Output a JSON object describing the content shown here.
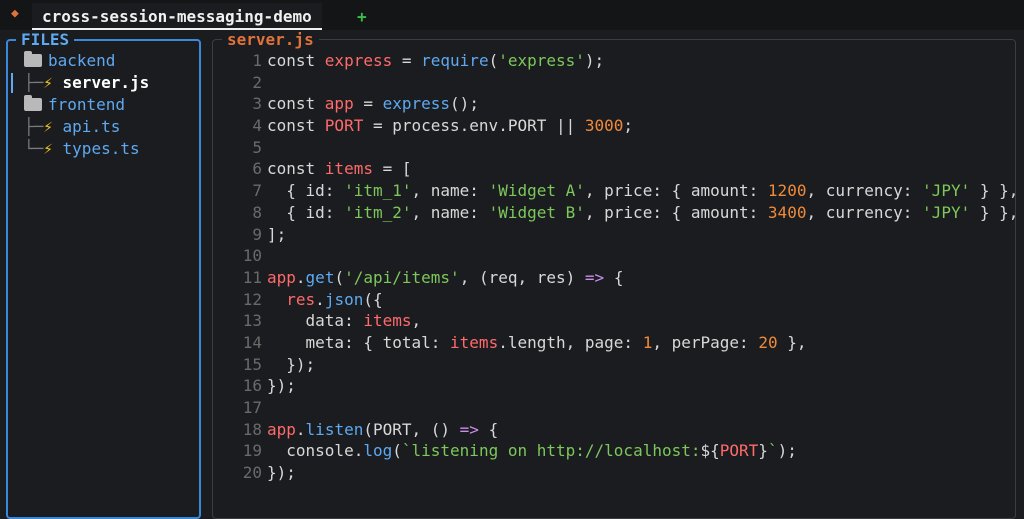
{
  "tabbar": {
    "active_tab": "cross-session-messaging-demo",
    "new_tab_label": "+"
  },
  "files": {
    "title": "FILES",
    "tree": [
      {
        "guide": "",
        "type": "folder",
        "label": "backend"
      },
      {
        "guide": "├─",
        "type": "file",
        "label": "server.js",
        "active": true
      },
      {
        "guide": "",
        "type": "folder",
        "label": "frontend"
      },
      {
        "guide": "├─",
        "type": "file",
        "label": "api.ts"
      },
      {
        "guide": "└─",
        "type": "file",
        "label": "types.ts"
      }
    ]
  },
  "editor": {
    "filename": "server.js",
    "line_numbers": [
      "1",
      "2",
      "3",
      "4",
      "5",
      "6",
      "7",
      "8",
      "9",
      "10",
      "11",
      "12",
      "13",
      "14",
      "15",
      "16",
      "17",
      "18",
      "19",
      "20"
    ],
    "lines": [
      [
        [
          "kw",
          "const "
        ],
        [
          "var",
          "express"
        ],
        [
          "txt",
          " = "
        ],
        [
          "fn",
          "require"
        ],
        [
          "txt",
          "("
        ],
        [
          "str",
          "'express'"
        ],
        [
          "txt",
          ");"
        ]
      ],
      [],
      [
        [
          "kw",
          "const "
        ],
        [
          "var",
          "app"
        ],
        [
          "txt",
          " = "
        ],
        [
          "fn",
          "express"
        ],
        [
          "txt",
          "();"
        ]
      ],
      [
        [
          "kw",
          "const "
        ],
        [
          "var",
          "PORT"
        ],
        [
          "txt",
          " = process.env.PORT || "
        ],
        [
          "num",
          "3000"
        ],
        [
          "txt",
          ";"
        ]
      ],
      [],
      [
        [
          "kw",
          "const "
        ],
        [
          "var",
          "items"
        ],
        [
          "txt",
          " = ["
        ]
      ],
      [
        [
          "txt",
          "  { id: "
        ],
        [
          "str",
          "'itm_1'"
        ],
        [
          "txt",
          ", name: "
        ],
        [
          "str",
          "'Widget A'"
        ],
        [
          "txt",
          ", price: { amount: "
        ],
        [
          "num",
          "1200"
        ],
        [
          "txt",
          ", currency: "
        ],
        [
          "str",
          "'JPY'"
        ],
        [
          "txt",
          " } },"
        ]
      ],
      [
        [
          "txt",
          "  { id: "
        ],
        [
          "str",
          "'itm_2'"
        ],
        [
          "txt",
          ", name: "
        ],
        [
          "str",
          "'Widget B'"
        ],
        [
          "txt",
          ", price: { amount: "
        ],
        [
          "num",
          "3400"
        ],
        [
          "txt",
          ", currency: "
        ],
        [
          "str",
          "'JPY'"
        ],
        [
          "txt",
          " } },"
        ]
      ],
      [
        [
          "txt",
          "];"
        ]
      ],
      [],
      [
        [
          "var",
          "app"
        ],
        [
          "txt",
          "."
        ],
        [
          "fn",
          "get"
        ],
        [
          "txt",
          "("
        ],
        [
          "str",
          "'/api/items'"
        ],
        [
          "txt",
          ", (req, res) "
        ],
        [
          "op",
          "=>"
        ],
        [
          "txt",
          " {"
        ]
      ],
      [
        [
          "txt",
          "  "
        ],
        [
          "var",
          "res"
        ],
        [
          "txt",
          "."
        ],
        [
          "fn",
          "json"
        ],
        [
          "txt",
          "({"
        ]
      ],
      [
        [
          "txt",
          "    data: "
        ],
        [
          "var",
          "items"
        ],
        [
          "txt",
          ","
        ]
      ],
      [
        [
          "txt",
          "    meta: { total: "
        ],
        [
          "var",
          "items"
        ],
        [
          "txt",
          ".length, page: "
        ],
        [
          "num",
          "1"
        ],
        [
          "txt",
          ", perPage: "
        ],
        [
          "num",
          "20"
        ],
        [
          "txt",
          " },"
        ]
      ],
      [
        [
          "txt",
          "  });"
        ]
      ],
      [
        [
          "txt",
          "});"
        ]
      ],
      [],
      [
        [
          "var",
          "app"
        ],
        [
          "txt",
          "."
        ],
        [
          "fn",
          "listen"
        ],
        [
          "txt",
          "(PORT, () "
        ],
        [
          "op",
          "=>"
        ],
        [
          "txt",
          " {"
        ]
      ],
      [
        [
          "txt",
          "  console."
        ],
        [
          "fn",
          "log"
        ],
        [
          "txt",
          "("
        ],
        [
          "str",
          "`listening on http://localhost:"
        ],
        [
          "txt",
          "${"
        ],
        [
          "var",
          "PORT"
        ],
        [
          "txt",
          "}"
        ],
        [
          "str",
          "`"
        ],
        [
          "txt",
          ");"
        ]
      ],
      [
        [
          "txt",
          "});"
        ]
      ]
    ]
  },
  "icons": {
    "app": "diamond-icon",
    "folder": "folder-icon",
    "file": "bolt-icon"
  },
  "colors": {
    "accent_blue": "#3a89d9",
    "title_orange": "#e0723b",
    "new_tab_green": "#3bbf4a"
  }
}
